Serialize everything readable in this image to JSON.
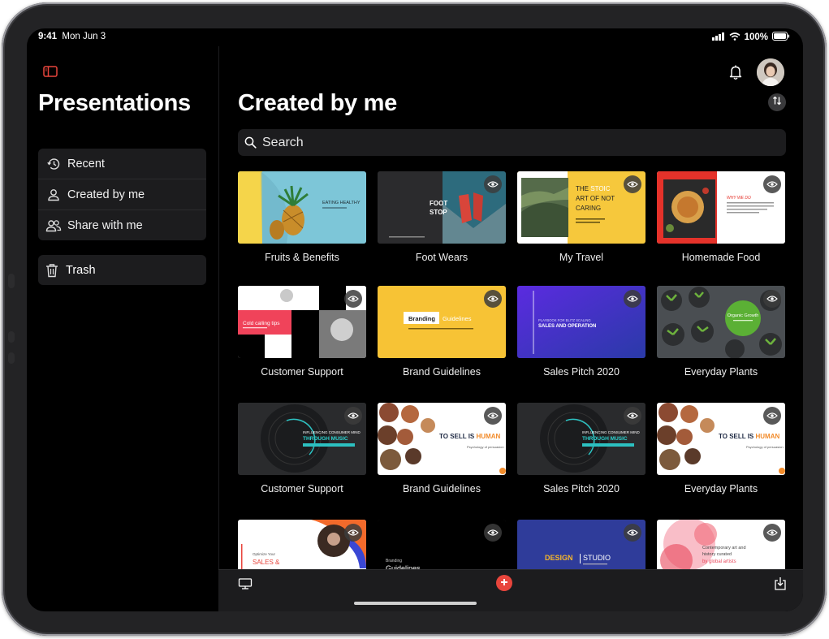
{
  "status": {
    "time": "9:41",
    "date": "Mon Jun 3",
    "battery": "100%"
  },
  "sidebar": {
    "title": "Presentations",
    "items": [
      {
        "label": "Recent",
        "icon": "history-icon"
      },
      {
        "label": "Created by me",
        "icon": "person-icon"
      },
      {
        "label": "Share with me",
        "icon": "people-icon"
      }
    ],
    "trash": {
      "label": "Trash",
      "icon": "trash-icon"
    }
  },
  "main": {
    "title": "Created by me",
    "search_placeholder": "Search",
    "cards": [
      {
        "title": "Fruits & Benefits",
        "thumb_text": "EATING HEALTHY"
      },
      {
        "title": "Foot Wears",
        "thumb_text": "FOOT STOP"
      },
      {
        "title": "My Travel",
        "thumb_text": "THE STOIC ART OF NOT CARING"
      },
      {
        "title": "Homemade Food",
        "thumb_text": "WHY WE DO"
      },
      {
        "title": "Customer Support",
        "thumb_text": "Cold calling tips"
      },
      {
        "title": "Brand Guidelines",
        "thumb_text": "Branding Guidelines"
      },
      {
        "title": "Sales Pitch 2020",
        "thumb_text": "SALES AND OPERATION"
      },
      {
        "title": "Everyday Plants",
        "thumb_text": "Organic Growth"
      },
      {
        "title": "Customer Support",
        "thumb_text": "INFLUENCING CONSUMER MIND THROUGH MUSIC"
      },
      {
        "title": "Brand Guidelines",
        "thumb_text": "TO SELL IS HUMAN"
      },
      {
        "title": "Sales Pitch 2020",
        "thumb_text": "INFLUENCING CONSUMER MIND THROUGH MUSIC"
      },
      {
        "title": "Everyday Plants",
        "thumb_text": "TO SELL IS HUMAN"
      },
      {
        "title": "",
        "thumb_text": "SALES &"
      },
      {
        "title": "",
        "thumb_text": "Branding Guidelines"
      },
      {
        "title": "",
        "thumb_text": "DESIGN STUDIO"
      },
      {
        "title": "",
        "thumb_text": "by global artists"
      }
    ]
  },
  "colors": {
    "accent": "#e8453c",
    "background": "#000000",
    "surface": "#1c1c1e"
  }
}
